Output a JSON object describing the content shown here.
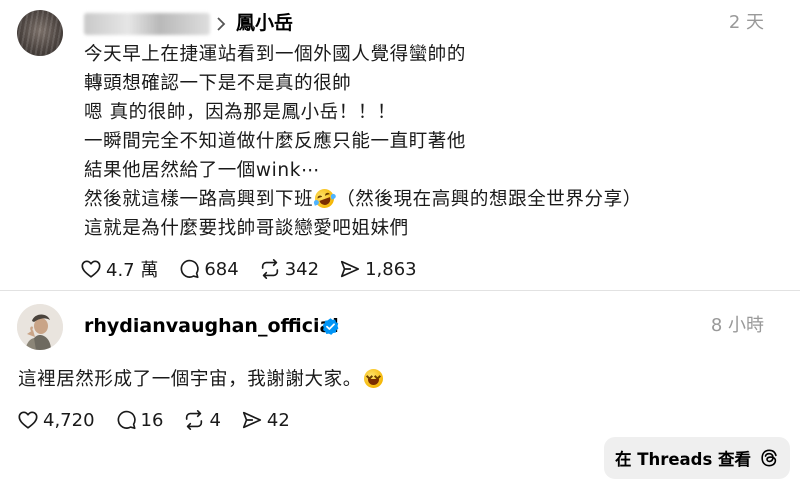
{
  "post1": {
    "author": "鳳小岳",
    "time": "2 天",
    "lines": [
      "今天早上在捷運站看到一個外國人覺得蠻帥的",
      "轉頭想確認一下是不是真的很帥",
      "嗯 真的很帥，因為那是鳳小岳！！！",
      "一瞬間完全不知道做什麼反應只能一直盯著他",
      "結果他居然給了一個wink⋯"
    ],
    "line6_before": "然後就這樣一路高興到下班",
    "line6_after": "（然後現在高興的想跟全世界分享）",
    "line7": "這就是為什麼要找帥哥談戀愛吧姐妹們",
    "emoji_rofl": "rolling-on-floor-laughing-emoji",
    "likes": "4.7 萬",
    "replies": "684",
    "reposts": "342",
    "shares": "1,863"
  },
  "post2": {
    "author": "rhydianvaughan_official",
    "time": "8 小時",
    "text": "這裡居然形成了一個宇宙，我謝謝大家。",
    "emoji_laugh": "laughing-squinting-emoji",
    "likes": "4,720",
    "replies": "16",
    "reposts": "4",
    "shares": "42"
  },
  "threads_button": {
    "label": "在 Threads 查看"
  },
  "colors": {
    "verified": "#0095f6",
    "muted_text": "#999999",
    "button_bg": "#efefef"
  }
}
